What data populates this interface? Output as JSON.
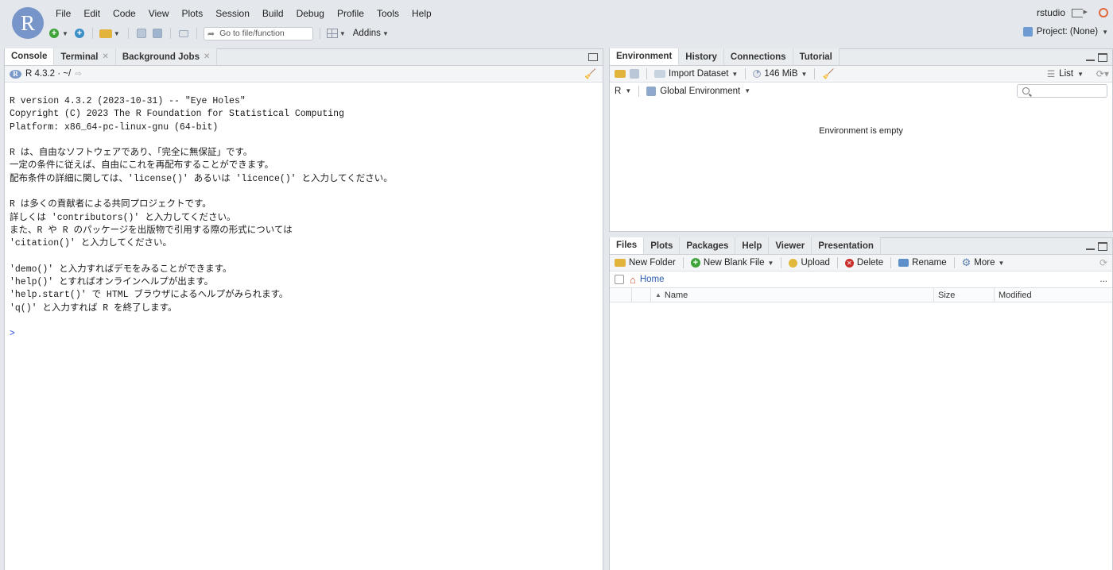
{
  "app": {
    "logo": "R"
  },
  "menu": [
    "File",
    "Edit",
    "Code",
    "View",
    "Plots",
    "Session",
    "Build",
    "Debug",
    "Profile",
    "Tools",
    "Help"
  ],
  "user": {
    "name": "rstudio"
  },
  "toolbar": {
    "goto_placeholder": "Go to file/function",
    "addins": "Addins"
  },
  "project": {
    "label": "Project: (None)"
  },
  "left_pane": {
    "tabs": [
      {
        "label": "Console",
        "closable": false
      },
      {
        "label": "Terminal",
        "closable": true
      },
      {
        "label": "Background Jobs",
        "closable": true
      }
    ],
    "path": "R 4.3.2 · ~/",
    "console_lines": [
      "R version 4.3.2 (2023-10-31) -- \"Eye Holes\"",
      "Copyright (C) 2023 The R Foundation for Statistical Computing",
      "Platform: x86_64-pc-linux-gnu (64-bit)",
      "",
      "R は、自由なソフトウェアであり、「完全に無保証」です。",
      "一定の条件に従えば、自由にこれを再配布することができます。",
      "配布条件の詳細に関しては、'license()' あるいは 'licence()' と入力してください。",
      "",
      "R は多くの貢献者による共同プロジェクトです。",
      "詳しくは 'contributors()' と入力してください。",
      "また、R や R のパッケージを出版物で引用する際の形式については",
      "'citation()' と入力してください。",
      "",
      "'demo()' と入力すればデモをみることができます。",
      "'help()' とすればオンラインヘルプが出ます。",
      "'help.start()' で HTML ブラウザによるヘルプがみられます。",
      "'q()' と入力すれば R を終了します。",
      ""
    ],
    "prompt": ">"
  },
  "env_pane": {
    "tabs": [
      "Environment",
      "History",
      "Connections",
      "Tutorial"
    ],
    "import_dataset": "Import Dataset",
    "memory": "146 MiB",
    "view_mode": "List",
    "language": "R",
    "scope": "Global Environment",
    "empty_message": "Environment is empty"
  },
  "files_pane": {
    "tabs": [
      "Files",
      "Plots",
      "Packages",
      "Help",
      "Viewer",
      "Presentation"
    ],
    "actions": {
      "new_folder": "New Folder",
      "new_blank_file": "New Blank File",
      "upload": "Upload",
      "delete": "Delete",
      "rename": "Rename",
      "more": "More"
    },
    "breadcrumb": "Home",
    "overflow": "...",
    "columns": {
      "name": "Name",
      "size": "Size",
      "modified": "Modified"
    }
  },
  "colors": {
    "background": "#e4e8ed",
    "accent": "#7795c8",
    "prompt": "#2b4fd8",
    "link": "#2a5db0"
  }
}
